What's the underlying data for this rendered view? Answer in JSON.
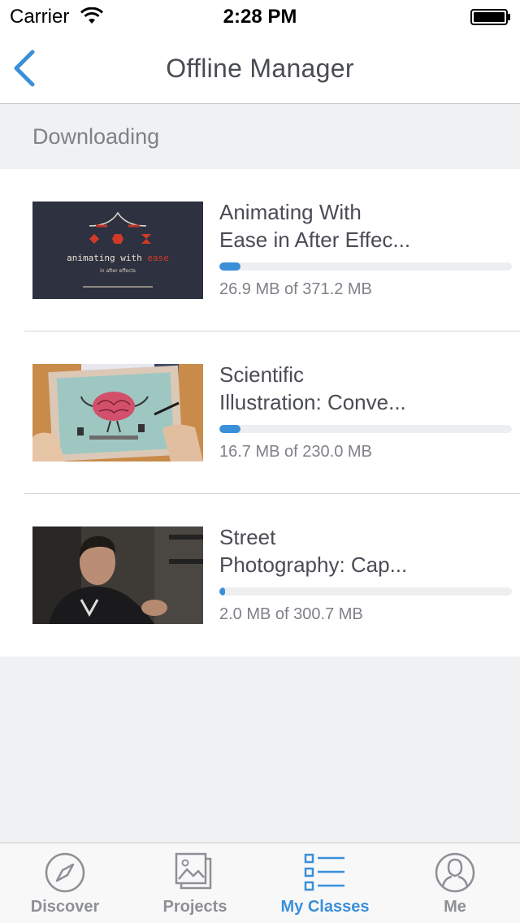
{
  "status_bar": {
    "carrier": "Carrier",
    "time": "2:28 PM"
  },
  "nav": {
    "title": "Offline Manager",
    "back_icon": "chevron-left-icon"
  },
  "section": {
    "title": "Downloading"
  },
  "downloads": [
    {
      "title_line1": "Animating With",
      "title_line2": "Ease in After Effec...",
      "size_text": "26.9 MB of 371.2 MB",
      "progress": 0.072,
      "thumb_text": "animating with ",
      "thumb_text_accent": "ease",
      "thumb_subtext": "in after effects"
    },
    {
      "title_line1": "Scientific",
      "title_line2": "Illustration: Conve...",
      "size_text": "16.7 MB of 230.0 MB",
      "progress": 0.073
    },
    {
      "title_line1": "Street",
      "title_line2": "Photography: Cap...",
      "size_text": "2.0 MB of 300.7 MB",
      "progress": 0.0067
    }
  ],
  "tabs": [
    {
      "label": "Discover",
      "icon": "compass-icon",
      "active": false
    },
    {
      "label": "Projects",
      "icon": "photos-icon",
      "active": false
    },
    {
      "label": "My Classes",
      "icon": "list-icon",
      "active": true
    },
    {
      "label": "Me",
      "icon": "person-icon",
      "active": false
    }
  ],
  "colors": {
    "accent": "#3a8fd9",
    "text": "#4a4c54",
    "muted": "#7f8188",
    "background": "#f0f1f3"
  }
}
